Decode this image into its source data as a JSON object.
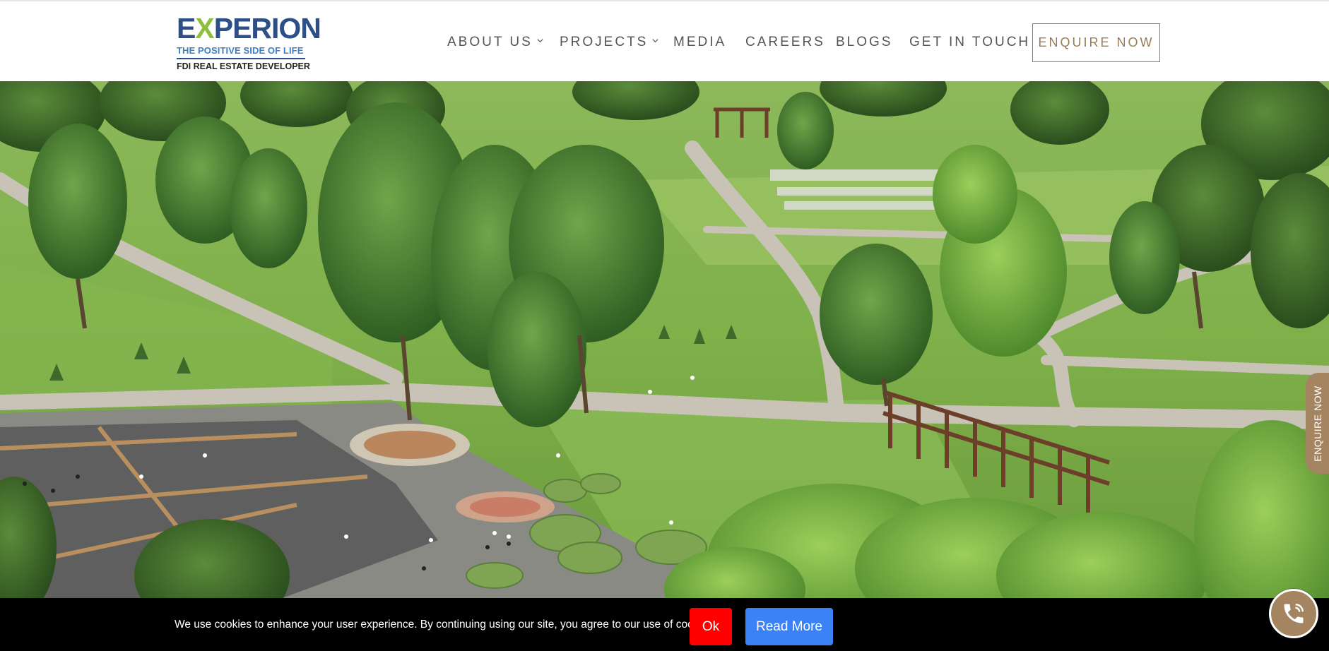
{
  "logo": {
    "word_start": "E",
    "word_x": "X",
    "word_end": "PERION",
    "tagline": "THE POSITIVE SIDE OF LIFE",
    "subtitle": "FDI REAL ESTATE DEVELOPER",
    "colors": {
      "primary": "#2b4f86",
      "accent": "#8cbf3f",
      "tagline": "#3d7fc1"
    }
  },
  "nav": {
    "items": [
      {
        "label": "ABOUT US",
        "has_dropdown": true
      },
      {
        "label": "PROJECTS",
        "has_dropdown": true
      },
      {
        "label": "MEDIA",
        "has_dropdown": false
      },
      {
        "label": "CAREERS",
        "has_dropdown": false
      },
      {
        "label": "BLOGS",
        "has_dropdown": false
      },
      {
        "label": "GET IN TOUCH",
        "has_dropdown": false
      }
    ],
    "cta_label": "ENQUIRE NOW"
  },
  "hero": {
    "image_icon": "park-aerial-photo",
    "side_tab_label": "ENQUIRE NOW"
  },
  "cookie": {
    "message": "We use cookies to enhance your user experience. By continuing using our site, you agree to our use of cookies.",
    "ok_label": "Ok",
    "read_more_label": "Read More",
    "colors": {
      "bar": "#000000",
      "ok": "#ff0000",
      "read_more": "#3b82f6"
    }
  },
  "call_button": {
    "icon": "phone-icon"
  },
  "colors": {
    "brand_gold": "#a58561",
    "nav_text": "#555555"
  }
}
